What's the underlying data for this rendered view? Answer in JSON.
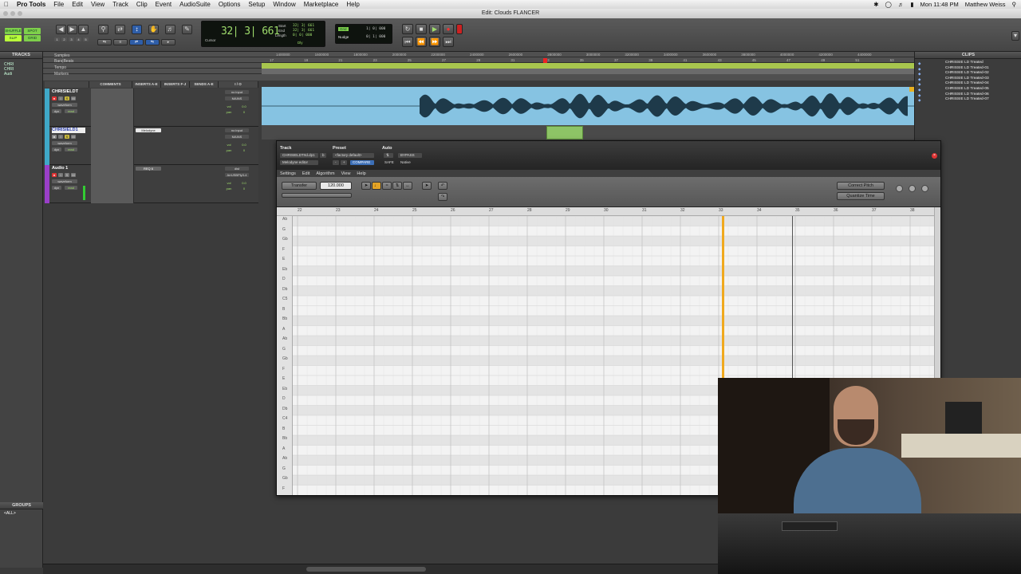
{
  "menubar": {
    "app": "Pro Tools",
    "items": [
      "File",
      "Edit",
      "View",
      "Track",
      "Clip",
      "Event",
      "AudioSuite",
      "Options",
      "Setup",
      "Window",
      "Marketplace",
      "Help"
    ],
    "clock": "Mon 11:48 PM",
    "user": "Matthew Weiss"
  },
  "window": {
    "title": "Edit: Clouds FLANCER"
  },
  "toolbar": {
    "modes": [
      "SHUFFLE",
      "SPOT",
      "SLIP",
      "GRID"
    ],
    "zoom_presets": [
      "1",
      "2",
      "3",
      "4",
      "5"
    ],
    "counter": {
      "main": "32| 3| 661",
      "mode_label": "Cursor",
      "start_label": "Start",
      "end_label": "End",
      "length_label": "Length",
      "start": "32| 3| 661",
      "end": "32| 3| 661",
      "length": "0| 0| 000",
      "dly_label": "Dly"
    },
    "grid_label": "Grid",
    "grid_value": "1| 0| 000",
    "nudge_label": "Nudge",
    "nudge_value": "0| 1| 000"
  },
  "tracks_pane": {
    "title": "TRACKS",
    "items": [
      "CHRI",
      "CHRI",
      "Audi"
    ]
  },
  "groups_pane": {
    "title": "GROUPS",
    "items": [
      "<ALL>"
    ]
  },
  "rulers": {
    "labels": [
      "Samples",
      "Bars|Beats",
      "Tempo",
      "Markers"
    ],
    "samples": [
      "1400000",
      "1600000",
      "1800000",
      "2000000",
      "2200000",
      "2400000",
      "2600000",
      "2800000",
      "3000000",
      "3200000",
      "3400000",
      "3600000",
      "3800000",
      "4000000",
      "4200000",
      "4400000"
    ],
    "bars": [
      "17",
      "19",
      "21",
      "23",
      "25",
      "27",
      "29",
      "31",
      "33",
      "35",
      "37",
      "39",
      "41",
      "43",
      "45",
      "47",
      "49",
      "51",
      "53"
    ]
  },
  "columns": [
    "COMMENTS",
    "INSERTS A-E",
    "INSERTS F-J",
    "SENDS A-E",
    "I / O"
  ],
  "tracks": [
    {
      "name": "CHRISIELDT",
      "view": "waveform",
      "input": "no input",
      "output": "MAINS",
      "vol": "0.0",
      "pan": "0",
      "insert": ""
    },
    {
      "name": "CHRISIELD1",
      "view": "waveform",
      "input": "no input",
      "output": "MAINS",
      "vol": "0.0",
      "pan": "0",
      "insert": "Melodyne"
    },
    {
      "name": "Audio 1",
      "view": "waveform",
      "input": "dist",
      "output": "ArrUSBPly3-4",
      "vol": "0.0",
      "pan": "0",
      "insert": "REQ 6"
    }
  ],
  "clips_pane": {
    "title": "CLIPS",
    "items": [
      "CHRISSIE LD Treated",
      "CHRISSIE LD Treated-01",
      "CHRISSIE LD Treated-02",
      "CHRISSIE LD Treated-03",
      "CHRISSIE LD Treated-04",
      "CHRISSIE LD Treated-05",
      "CHRISSIE LD Treated-06",
      "CHRISSIE LD Treated-07"
    ]
  },
  "melodyne": {
    "track_label": "Track",
    "preset_label": "Preset",
    "auto_label": "Auto",
    "track_value": "CHRISIELDTrtd.dp1",
    "track_sub": "b",
    "preset_value": "<factory default>",
    "compare": "COMPARE",
    "bypass": "BYPASS",
    "safe": "SAFE",
    "native": "Native",
    "plugin_name": "Melodyne editor",
    "menu": [
      "Settings",
      "Edit",
      "Algorithm",
      "View",
      "Help"
    ],
    "transfer": "Transfer",
    "tempo": "120.000",
    "correct_pitch": "Correct Pitch",
    "quantize_time": "Quantize Time",
    "bars": [
      "22",
      "23",
      "24",
      "25",
      "26",
      "27",
      "28",
      "29",
      "30",
      "31",
      "32",
      "33",
      "34",
      "35",
      "36",
      "37",
      "38"
    ],
    "notes": [
      "Ab",
      "G",
      "Gb",
      "F",
      "E",
      "Eb",
      "D",
      "Db",
      "C5",
      "B",
      "Bb",
      "A",
      "Ab",
      "G",
      "Gb",
      "F",
      "E",
      "Eb",
      "D",
      "Db",
      "C4",
      "B",
      "Bb",
      "A",
      "Ab",
      "G",
      "Gb",
      "F"
    ]
  },
  "colors": {
    "accent": "#2f5ea8",
    "waveform": "#86c3e2",
    "clip_green": "#8dc466",
    "counter_green": "#9fdc6c"
  }
}
